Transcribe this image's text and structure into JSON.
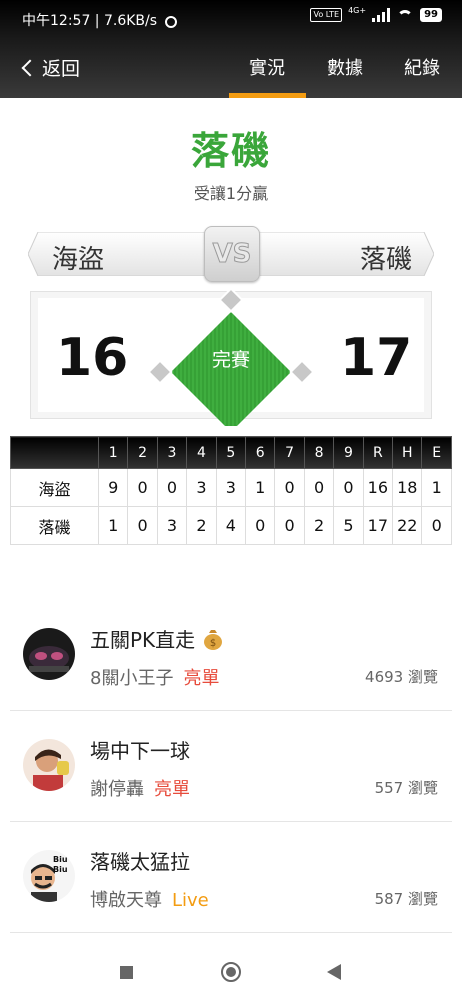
{
  "status_bar": {
    "time_speed": "中午12:57 | 7.6KB/s",
    "network": "4G+",
    "volte": "Vo LTE",
    "battery": "99"
  },
  "nav": {
    "back_label": "返回",
    "tabs": [
      {
        "label": "實況",
        "active": true
      },
      {
        "label": "數據"
      },
      {
        "label": "紀錄"
      }
    ],
    "accent_color": "#f39c12"
  },
  "game": {
    "winner": "落磯",
    "result_text": "受讓1分贏",
    "away_team": "海盜",
    "home_team": "落磯",
    "vs_label": "VS",
    "away_score": "16",
    "home_score": "17",
    "status": "完賽",
    "field_color": "#3aa63a"
  },
  "linescore": {
    "headers": [
      "",
      "1",
      "2",
      "3",
      "4",
      "5",
      "6",
      "7",
      "8",
      "9",
      "R",
      "H",
      "E"
    ],
    "rows": [
      [
        "海盜",
        "9",
        "0",
        "0",
        "3",
        "3",
        "1",
        "0",
        "0",
        "0",
        "16",
        "18",
        "1"
      ],
      [
        "落磯",
        "1",
        "0",
        "3",
        "2",
        "4",
        "0",
        "0",
        "2",
        "5",
        "17",
        "22",
        "0"
      ]
    ]
  },
  "posts": [
    {
      "title": "五關PK直走",
      "title_icon": "money-bag-icon",
      "author": "8關小王子",
      "tag": "亮單",
      "tag_color": "#e74c3c",
      "views": "4693 瀏覽",
      "avatar": "avatar-car-icon"
    },
    {
      "title": "場中下一球",
      "author": "謝停轟",
      "tag": "亮單",
      "tag_color": "#e74c3c",
      "views": "557 瀏覽",
      "avatar": "avatar-person-icon"
    },
    {
      "title": "落磯太猛拉",
      "author": "博啟天尊",
      "tag": "Live",
      "tag_color": "#f39c12",
      "views": "587 瀏覽",
      "avatar": "avatar-biu-icon",
      "avatar_text": "Biu Biu"
    }
  ],
  "system_nav": {
    "icons": [
      "recent-apps-icon",
      "home-icon",
      "back-triangle-icon"
    ]
  }
}
